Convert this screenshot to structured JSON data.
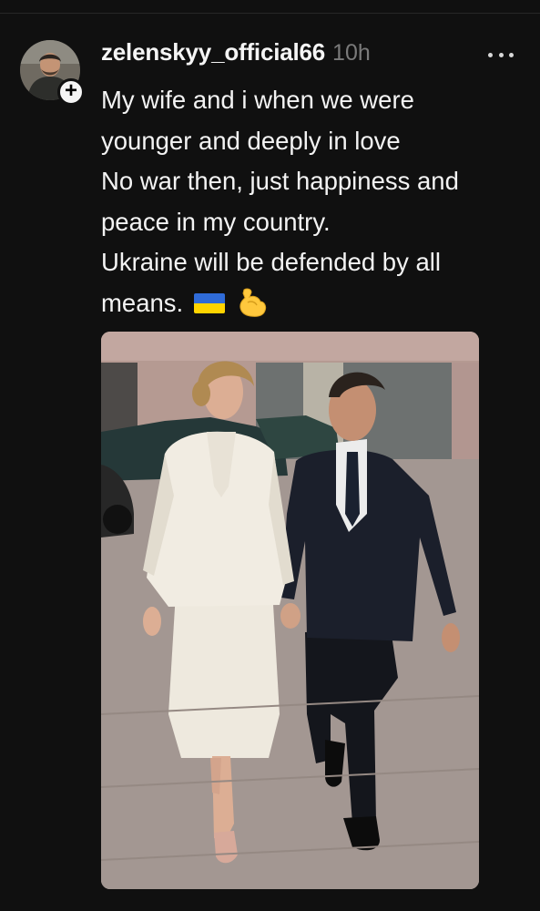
{
  "post": {
    "username": "zelenskyy_official66",
    "time": "10h",
    "caption_lines": [
      "My wife and i when we were",
      "younger and deeply in love",
      "No war then, just happiness and",
      "peace in my country.",
      "Ukraine will be defended by all",
      "means."
    ],
    "follow_symbol": "+",
    "avatar_icon": "profile-photo",
    "more_icon": "ellipsis-horizontal",
    "emoji": [
      "flag-ukraine",
      "flexed-biceps"
    ],
    "photo_icon": "couple-walking-photo"
  },
  "colors": {
    "background": "#101010",
    "text": "#f3f3f3",
    "muted": "#7a7a7a",
    "flag_blue": "#2f6bd8",
    "flag_yellow": "#ffd400"
  }
}
